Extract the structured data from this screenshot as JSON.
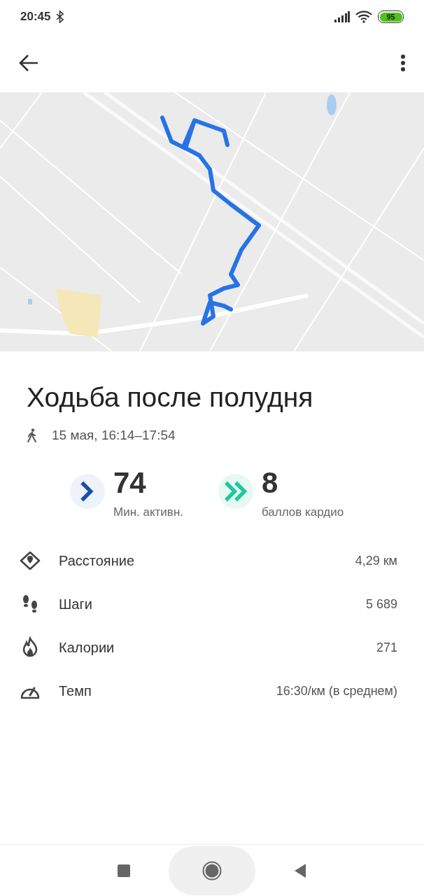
{
  "status_bar": {
    "time": "20:45",
    "battery": "95"
  },
  "workout": {
    "title": "Ходьба после полудня",
    "date": "15 мая, 16:14–17:54"
  },
  "metrics": [
    {
      "value": "74",
      "label": "Мин. активн.",
      "color": "#1a4fa8"
    },
    {
      "value": "8",
      "label": "баллов кардио",
      "color": "#1ec8a0"
    }
  ],
  "stats": [
    {
      "label": "Расстояние",
      "value": "4,29 км"
    },
    {
      "label": "Шаги",
      "value": "5 689"
    },
    {
      "label": "Калории",
      "value": "271"
    },
    {
      "label": "Темп",
      "value": "16:30/км (в среднем)"
    }
  ]
}
